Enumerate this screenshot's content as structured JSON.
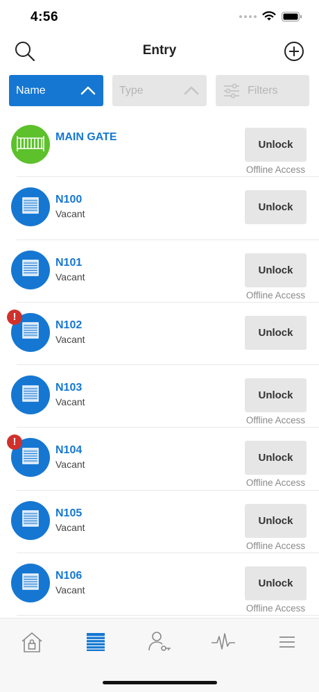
{
  "status": {
    "time": "4:56"
  },
  "header": {
    "title": "Entry"
  },
  "filters": {
    "name_label": "Name",
    "type_label": "Type",
    "filters_label": "Filters"
  },
  "colors": {
    "accent": "#1577d2",
    "gate_green": "#5cc12b",
    "alert_red": "#d0312b",
    "chip_gray": "#e6e6e6"
  },
  "unlock_label": "Unlock",
  "offline_label": "Offline Access",
  "alert_symbol": "!",
  "entries": [
    {
      "title": "MAIN GATE",
      "subtitle": "",
      "icon": "gate-icon",
      "offline": true,
      "alert": false
    },
    {
      "title": "N100",
      "subtitle": "Vacant",
      "icon": "storage-door-icon",
      "offline": false,
      "alert": false
    },
    {
      "title": "N101",
      "subtitle": "Vacant",
      "icon": "storage-door-icon",
      "offline": true,
      "alert": false
    },
    {
      "title": "N102",
      "subtitle": "Vacant",
      "icon": "storage-door-icon",
      "offline": false,
      "alert": true
    },
    {
      "title": "N103",
      "subtitle": "Vacant",
      "icon": "storage-door-icon",
      "offline": true,
      "alert": false
    },
    {
      "title": "N104",
      "subtitle": "Vacant",
      "icon": "storage-door-icon",
      "offline": true,
      "alert": true
    },
    {
      "title": "N105",
      "subtitle": "Vacant",
      "icon": "storage-door-icon",
      "offline": true,
      "alert": false
    },
    {
      "title": "N106",
      "subtitle": "Vacant",
      "icon": "storage-door-icon",
      "offline": true,
      "alert": false
    }
  ],
  "tabs": [
    {
      "icon": "home-lock-icon",
      "active": false
    },
    {
      "icon": "storage-door-icon",
      "active": true
    },
    {
      "icon": "user-key-icon",
      "active": false
    },
    {
      "icon": "activity-icon",
      "active": false
    },
    {
      "icon": "menu-icon",
      "active": false
    }
  ]
}
